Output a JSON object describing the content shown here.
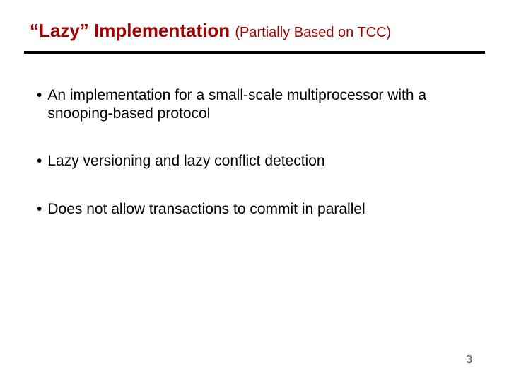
{
  "title": {
    "main": "“Lazy” Implementation ",
    "sub": "(Partially Based on TCC)"
  },
  "bullets": [
    "An implementation for a small-scale multiprocessor with a snooping-based protocol",
    "Lazy versioning and lazy conflict detection",
    "Does not allow transactions to commit in parallel"
  ],
  "page_number": "3"
}
